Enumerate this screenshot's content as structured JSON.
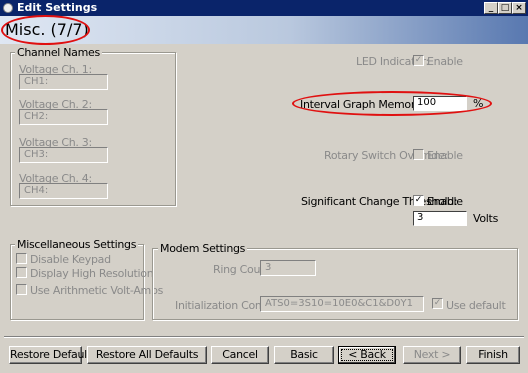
{
  "window": {
    "title": "Edit Settings",
    "minimize": "_",
    "maximize": "□",
    "close": "×"
  },
  "header": {
    "page_title": "Misc. (7/7)"
  },
  "channel_names": {
    "group_title": "Channel Names",
    "channels": [
      {
        "label": "Voltage Ch. 1:",
        "placeholder": "CH1:"
      },
      {
        "label": "Voltage Ch. 2:",
        "placeholder": "CH2:"
      },
      {
        "label": "Voltage Ch. 3:",
        "placeholder": "CH3:"
      },
      {
        "label": "Voltage Ch. 4:",
        "placeholder": "CH4:"
      }
    ]
  },
  "settings": {
    "led_indicator": {
      "label": "LED Indicator:",
      "checkbox_label": "Enable",
      "checked": true
    },
    "interval_graph": {
      "label": "Interval Graph Memory Usage:",
      "value": "100",
      "unit": "%"
    },
    "rotary_switch": {
      "label": "Rotary Switch Override:",
      "checkbox_label": "Enable",
      "checked": false
    },
    "significant_change": {
      "label": "Significant Change Threshold:",
      "checkbox_label": "Enable",
      "checked": true,
      "value": "3",
      "unit": "Volts"
    }
  },
  "misc_settings": {
    "group_title": "Miscellaneous Settings",
    "options": [
      "Disable Keypad",
      "Display High Resolution",
      "Use Arithmetic Volt-Amps"
    ]
  },
  "modem_settings": {
    "group_title": "Modem Settings",
    "ring_count_label": "Ring Count:",
    "ring_count_value": "3",
    "init_label": "Initialization Command:",
    "init_value": "ATS0=3S10=10E0&C1&D0Y1",
    "use_default_label": "Use default"
  },
  "buttons": {
    "restore_default": "Restore Default",
    "restore_all": "Restore All Defaults",
    "cancel": "Cancel",
    "basic": "Basic",
    "back": "< Back",
    "next": "Next >",
    "finish": "Finish"
  }
}
